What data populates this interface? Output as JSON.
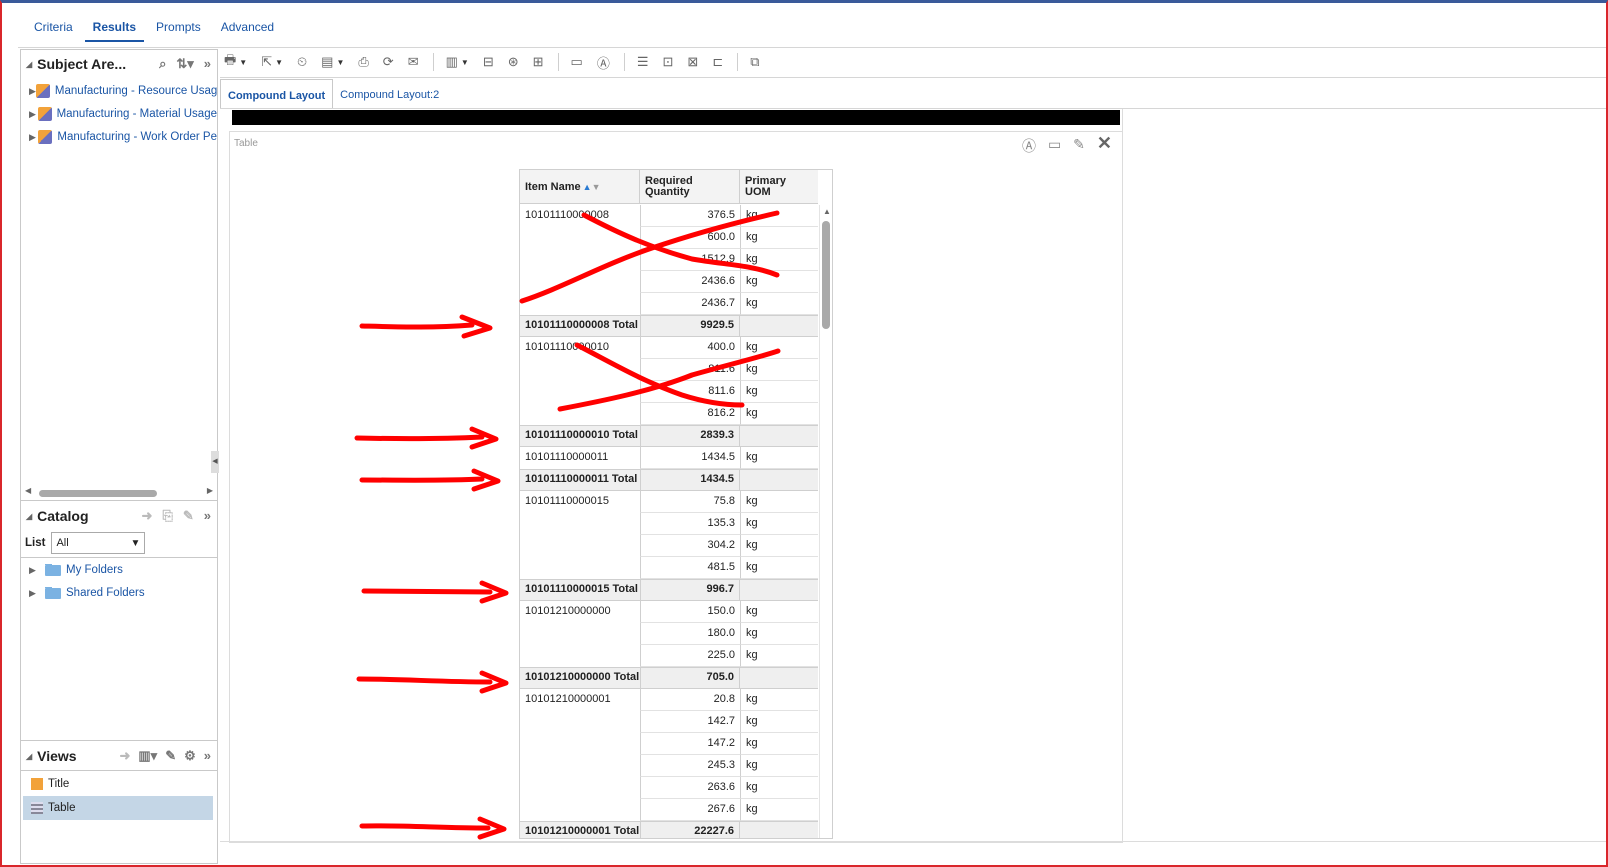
{
  "top_tabs": [
    "Criteria",
    "Results",
    "Prompts",
    "Advanced"
  ],
  "active_top_tab": "Results",
  "subject_areas": {
    "title": "Subject Are...",
    "items": [
      "Manufacturing - Resource Usag",
      "Manufacturing - Material Usage",
      "Manufacturing - Work Order Pe"
    ]
  },
  "catalog": {
    "title": "Catalog",
    "list_label": "List",
    "list_value": "All",
    "folders": [
      "My Folders",
      "Shared Folders"
    ]
  },
  "views": {
    "title": "Views",
    "items": [
      "Title",
      "Table"
    ],
    "selected": "Table"
  },
  "layout_tabs": [
    "Compound Layout",
    "Compound Layout:2"
  ],
  "active_layout_tab": "Compound Layout",
  "view_label": "Table",
  "table": {
    "headers": {
      "item": "Item Name",
      "qty_line1": "Required",
      "qty_line2": "Quantity",
      "uom_line1": "Primary",
      "uom_line2": "UOM"
    },
    "groups": [
      {
        "item": "10101110000008",
        "rows": [
          [
            "376.5",
            "kg"
          ],
          [
            "600.0",
            "kg"
          ],
          [
            "1512.9",
            "kg"
          ],
          [
            "2436.6",
            "kg"
          ],
          [
            "2436.7",
            "kg"
          ]
        ],
        "total_label": "10101110000008 Total",
        "total": "9929.5"
      },
      {
        "item": "10101110000010",
        "rows": [
          [
            "400.0",
            "kg"
          ],
          [
            "811.6",
            "kg"
          ],
          [
            "811.6",
            "kg"
          ],
          [
            "816.2",
            "kg"
          ]
        ],
        "total_label": "10101110000010 Total",
        "total": "2839.3"
      },
      {
        "item": "10101110000011",
        "rows": [
          [
            "1434.5",
            "kg"
          ]
        ],
        "total_label": "10101110000011 Total",
        "total": "1434.5"
      },
      {
        "item": "10101110000015",
        "rows": [
          [
            "75.8",
            "kg"
          ],
          [
            "135.3",
            "kg"
          ],
          [
            "304.2",
            "kg"
          ],
          [
            "481.5",
            "kg"
          ]
        ],
        "total_label": "10101110000015 Total",
        "total": "996.7"
      },
      {
        "item": "10101210000000",
        "rows": [
          [
            "150.0",
            "kg"
          ],
          [
            "180.0",
            "kg"
          ],
          [
            "225.0",
            "kg"
          ]
        ],
        "total_label": "10101210000000 Total",
        "total": "705.0"
      },
      {
        "item": "10101210000001",
        "rows": [
          [
            "20.8",
            "kg"
          ],
          [
            "142.7",
            "kg"
          ],
          [
            "147.2",
            "kg"
          ],
          [
            "245.3",
            "kg"
          ],
          [
            "263.6",
            "kg"
          ],
          [
            "267.6",
            "kg"
          ]
        ],
        "total_label": "10101210000001 Total",
        "total": "22227.6"
      }
    ]
  },
  "colors": {
    "accent": "#1a55a5",
    "annotation": "#ff0000",
    "frame": "#d9262b"
  }
}
